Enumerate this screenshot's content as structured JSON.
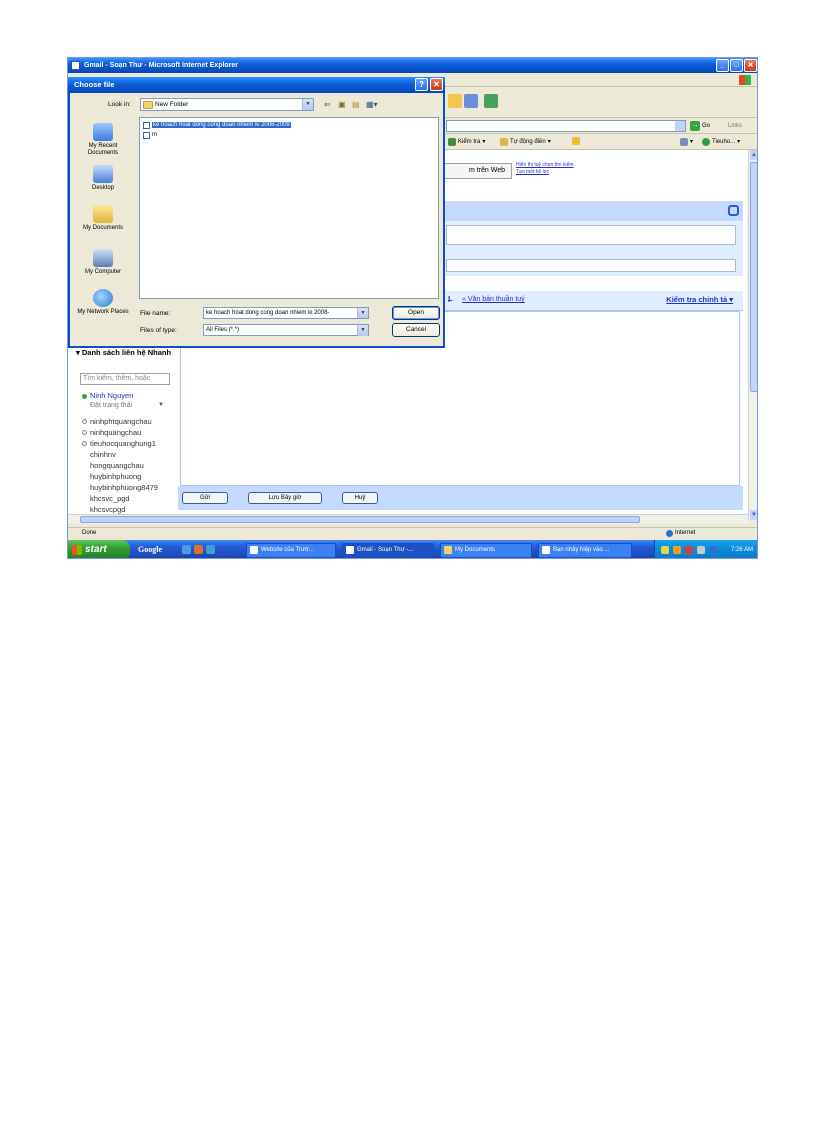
{
  "ie": {
    "title": "Gmail - Soạn Thư - Microsoft Internet Explorer",
    "go_label": "Go",
    "links_label": "Links",
    "google_toolbar": {
      "check_label": "Kiểm tra",
      "autofill_label": "Tự động điền",
      "user_label": "Tieuho..."
    },
    "status_text": "Done",
    "zone_text": "Internet"
  },
  "gmail": {
    "search_web_button": "m trên Web",
    "search_links": [
      "Hiển thị tuỳ chọn tìm kiếm",
      "Tạo một bộ lọc"
    ],
    "plain_text_link": "« Văn bản thuần tuý",
    "spellcheck_link": "Kiểm tra chính tả",
    "footer_buttons": [
      "Gửi",
      "Lưu Bây giờ",
      "Huỷ"
    ],
    "contacts": {
      "title": "Danh sách liên hệ Nhanh",
      "search_placeholder": "Tìm kiếm, thêm, hoặc",
      "me_name": "Ninh Nguyen",
      "me_status": "Đặt trạng thái",
      "list": [
        "ninhphtquangchau",
        "ninhquangchau",
        "tieuhocquanghung1",
        "chinhnv",
        "hongquangchau",
        "huybinhphuong",
        "huybinhphuong8479",
        "khcsvc_pgd",
        "khcsvcpgd"
      ]
    }
  },
  "dialog": {
    "title": "Choose file",
    "look_in_label": "Look in:",
    "look_in_value": "New Folder",
    "places": [
      "My Recent Documents",
      "Desktop",
      "My Documents",
      "My Computer",
      "My Network Places"
    ],
    "files": [
      {
        "name": "ke hoach hoat dong cong doan nhiem ki 2008-2009",
        "selected": true
      },
      {
        "name": "m",
        "selected": false
      }
    ],
    "file_name_label": "File name:",
    "file_name_value": "ke hoach hoat dong cong doan nhiem ki 2008-",
    "file_type_label": "Files of type:",
    "file_type_value": "All Files (*.*)",
    "open_button": "Open",
    "cancel_button": "Cancel"
  },
  "taskbar": {
    "start_label": "start",
    "google_label": "Google",
    "tasks": [
      "Website của Trườ...",
      "Gmail - Soạn Thư -...",
      "My Documents",
      "Bạn nhảy hiệp vào ..."
    ],
    "clock": "7:26 AM"
  }
}
